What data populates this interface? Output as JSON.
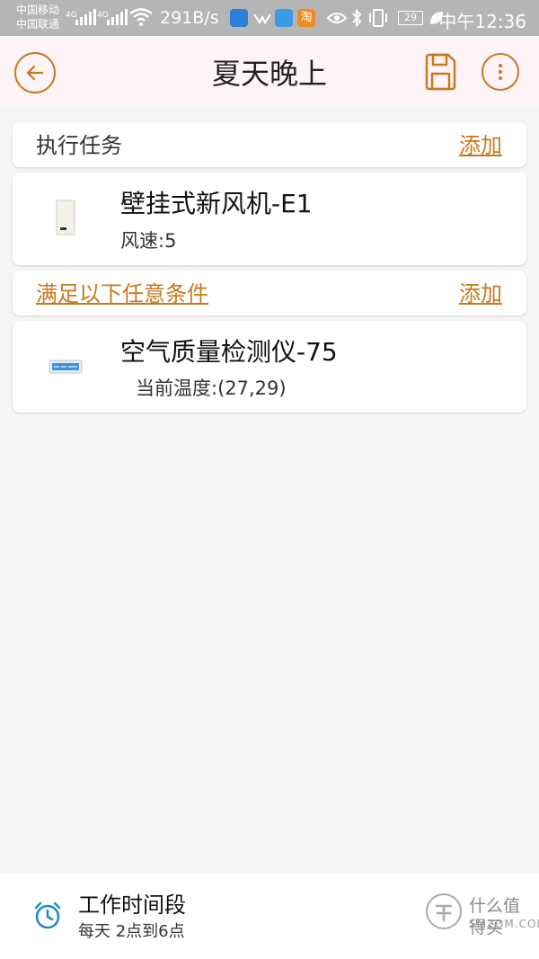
{
  "status_bar": {
    "carrier_1": "中国移动",
    "carrier_2": "中国联通",
    "net_1": "4G",
    "net_2": "4G",
    "speed": "291B/s",
    "battery": "29",
    "time": "中午12:36",
    "app_icon_3": "淘"
  },
  "header": {
    "title": "夏天晚上",
    "back_icon": "back-arrow-icon",
    "save_icon": "save-icon",
    "more_icon": "more-icon"
  },
  "tasks_section": {
    "title": "执行任务",
    "add_label": "添加"
  },
  "task_device": {
    "name": "壁挂式新风机-E1",
    "detail": "风速:5"
  },
  "conditions_section": {
    "title": "满足以下任意条件",
    "add_label": "添加"
  },
  "condition_device": {
    "name": "空气质量检测仪-75",
    "detail": "当前温度:(27,29)"
  },
  "bottom_bar": {
    "icon": "alarm-clock-icon",
    "title": "工作时间段",
    "subtitle": "每天 2点到6点"
  },
  "watermark": {
    "text": "什么值得买",
    "sub": "SMZDM.COM"
  },
  "colors": {
    "accent": "#c77a1d",
    "status_bar_bg": "#b5b5b5",
    "header_bg": "#fcf4f6",
    "page_bg": "#f5f5f5",
    "clock_icon": "#1e88c7"
  }
}
